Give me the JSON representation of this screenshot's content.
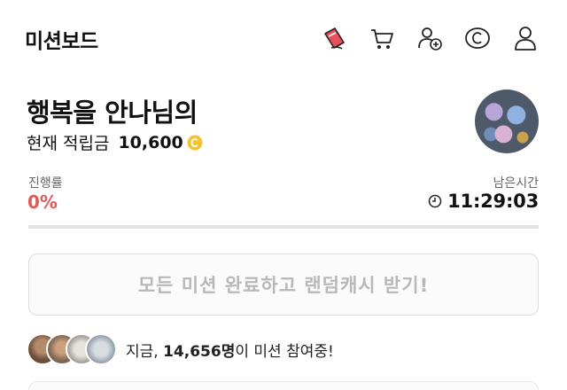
{
  "header": {
    "title": "미션보드",
    "icons": [
      "mission-card-icon",
      "cart-icon",
      "add-user-icon",
      "cash-icon",
      "profile-icon"
    ]
  },
  "user": {
    "name": "행복을 안나님의",
    "balance_label": "현재 적립금",
    "balance_value": "10,600"
  },
  "progress": {
    "label": "진행률",
    "value_text": "0%",
    "fraction": 0
  },
  "remaining": {
    "label": "남은시간",
    "time": "11:29:03"
  },
  "reward_button": {
    "label": "모든 미션 완료하고 랜덤캐시 받기!"
  },
  "participants": {
    "prefix": "지금, ",
    "count": "14,656명",
    "suffix": "이 미션 참여중!"
  },
  "colors": {
    "accent": "#e05a5a",
    "coin": "#f2c230",
    "disabled_text": "#b8b8b8"
  }
}
